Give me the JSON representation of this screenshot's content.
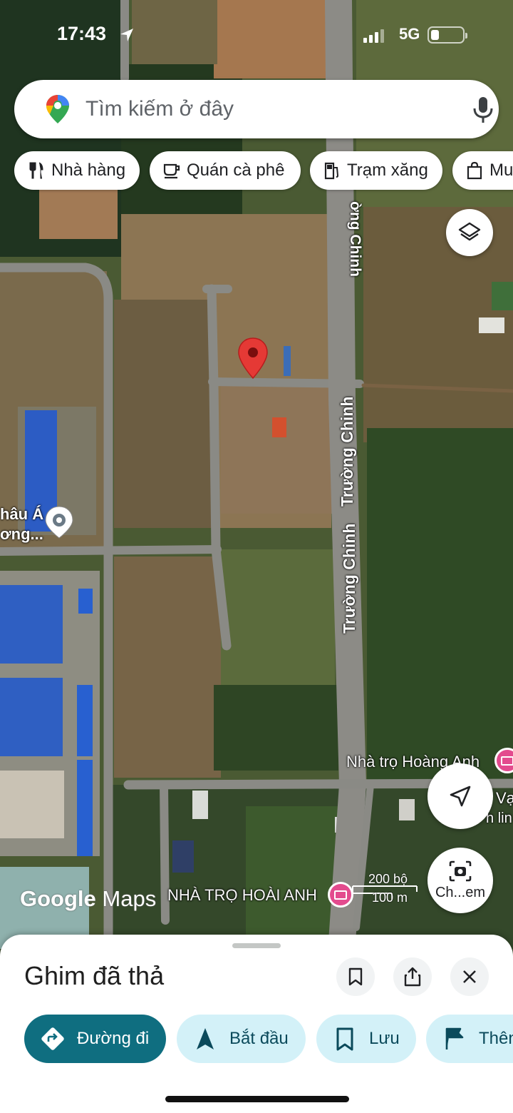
{
  "status_bar": {
    "time": "17:43",
    "network": "5G",
    "icons": [
      "location-arrow-icon",
      "signal-icon",
      "battery-icon"
    ]
  },
  "search": {
    "placeholder": "Tìm kiếm ở đây",
    "icons": [
      "google-maps-pin-icon",
      "microphone-icon"
    ]
  },
  "chips": [
    {
      "label": "Nhà hàng",
      "icon": "restaurant-icon"
    },
    {
      "label": "Quán cà phê",
      "icon": "coffee-icon"
    },
    {
      "label": "Trạm xăng",
      "icon": "gas-station-icon"
    },
    {
      "label": "Mu",
      "icon": "shopping-bag-icon"
    }
  ],
  "map": {
    "road_labels": [
      "ờng Chinh",
      "Trường Chinh",
      "Trường Chinh"
    ],
    "place_labels": [
      "hâu Á",
      "ơng...",
      "Nhà trọ Hoàng Anh",
      "NHÀ TRỌ HOÀI ANH",
      "Vạ",
      "h lin"
    ],
    "scale": {
      "upper": "200 bộ",
      "lower": "100 m"
    },
    "attribution": {
      "google": "Google",
      "maps": "Maps"
    },
    "dropped_pin_color": "#e53935",
    "poi_color": "#e34b8e"
  },
  "map_buttons": {
    "layers": "layers-icon",
    "locate": "navigation-arrow-icon",
    "lens_label": "Ch...em"
  },
  "sheet": {
    "title": "Ghim đã thả",
    "header_icons": [
      "bookmark-icon",
      "share-icon",
      "close-icon"
    ],
    "actions": [
      {
        "label": "Đường đi",
        "icon": "directions-icon",
        "primary": true
      },
      {
        "label": "Bắt đầu",
        "icon": "navigation-start-icon"
      },
      {
        "label": "Lưu",
        "icon": "bookmark-icon"
      },
      {
        "label": "Thên",
        "icon": "flag-icon"
      }
    ],
    "brand_color": "#0f6e80"
  }
}
